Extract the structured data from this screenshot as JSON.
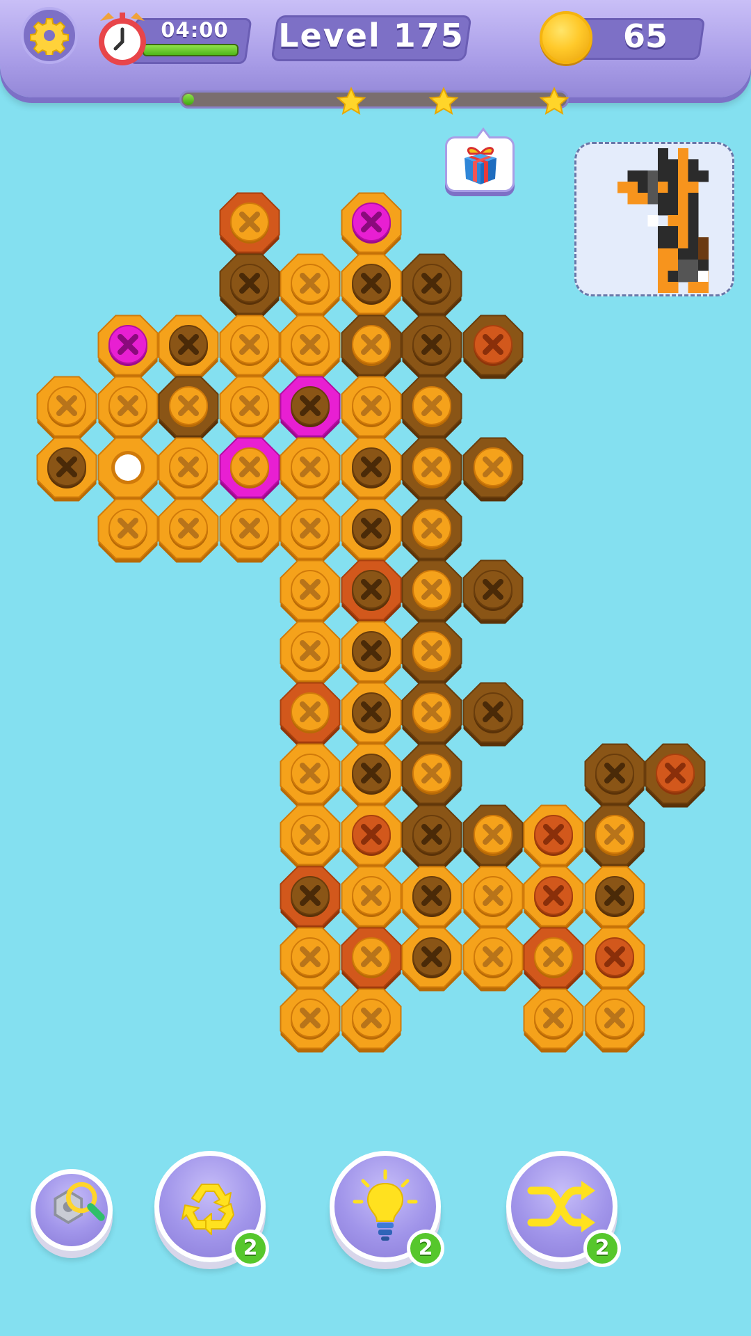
{
  "header": {
    "timer": "04:00",
    "timer_fraction": 1.0,
    "level_label": "Level 175",
    "coins": "65",
    "progress_fraction": 0.01,
    "stars": [
      "star-icon",
      "star-icon",
      "star-icon"
    ],
    "icons": {
      "settings": "gear-icon",
      "timer": "alarm-clock-icon",
      "coin": "coin-icon"
    }
  },
  "reward": {
    "icon": "gift-icon"
  },
  "target": {
    "icon": "pixel-giraffe-icon",
    "colors": {
      "black": "#2b2b2b",
      "gray": "#555555",
      "orange": "#f7941d",
      "white": "#ffffff",
      "brown": "#6b3a12"
    }
  },
  "bolt_colors": {
    "O": {
      "cap": "#f5a21b",
      "edge": "#d07a0a",
      "dark": "#b86a06",
      "hole": "#f7a826",
      "x": "#b8741a"
    },
    "D": {
      "cap": "#8a5516",
      "edge": "#6a3d0c",
      "dark": "#5a3208",
      "hole": "#7a4a12",
      "x": "#4a2a08"
    },
    "R": {
      "cap": "#d2581c",
      "edge": "#a9400e",
      "dark": "#8f350a",
      "hole": "#d2581c",
      "x": "#8a2f0a"
    },
    "P": {
      "cap": "#e81fd2",
      "edge": "#b40ea2",
      "dark": "#9c0a8d",
      "hole": "#e81fd2",
      "x": "#8a0a7c"
    }
  },
  "board": [
    {
      "r": 0,
      "c": 3,
      "rim": "R",
      "ctr": "O"
    },
    {
      "r": 0,
      "c": 5,
      "rim": "O",
      "ctr": "P"
    },
    {
      "r": 1,
      "c": 3,
      "rim": "D",
      "ctr": "D"
    },
    {
      "r": 1,
      "c": 4,
      "rim": "O",
      "ctr": "O"
    },
    {
      "r": 1,
      "c": 5,
      "rim": "O",
      "ctr": "D"
    },
    {
      "r": 1,
      "c": 6,
      "rim": "D",
      "ctr": "D"
    },
    {
      "r": 2,
      "c": 1,
      "rim": "O",
      "ctr": "P"
    },
    {
      "r": 2,
      "c": 2,
      "rim": "O",
      "ctr": "D"
    },
    {
      "r": 2,
      "c": 3,
      "rim": "O",
      "ctr": "O"
    },
    {
      "r": 2,
      "c": 4,
      "rim": "O",
      "ctr": "O"
    },
    {
      "r": 2,
      "c": 5,
      "rim": "D",
      "ctr": "O"
    },
    {
      "r": 2,
      "c": 6,
      "rim": "D",
      "ctr": "D"
    },
    {
      "r": 2,
      "c": 7,
      "rim": "D",
      "ctr": "R"
    },
    {
      "r": 3,
      "c": 0,
      "rim": "O",
      "ctr": "O"
    },
    {
      "r": 3,
      "c": 1,
      "rim": "O",
      "ctr": "O"
    },
    {
      "r": 3,
      "c": 2,
      "rim": "D",
      "ctr": "O"
    },
    {
      "r": 3,
      "c": 3,
      "rim": "O",
      "ctr": "O"
    },
    {
      "r": 3,
      "c": 4,
      "rim": "P",
      "ctr": "D"
    },
    {
      "r": 3,
      "c": 5,
      "rim": "O",
      "ctr": "O"
    },
    {
      "r": 3,
      "c": 6,
      "rim": "D",
      "ctr": "O"
    },
    {
      "r": 4,
      "c": 0,
      "rim": "O",
      "ctr": "D"
    },
    {
      "r": 4,
      "c": 1,
      "rim": "O",
      "ctr": "E"
    },
    {
      "r": 4,
      "c": 2,
      "rim": "O",
      "ctr": "O"
    },
    {
      "r": 4,
      "c": 3,
      "rim": "P",
      "ctr": "O"
    },
    {
      "r": 4,
      "c": 4,
      "rim": "O",
      "ctr": "O"
    },
    {
      "r": 4,
      "c": 5,
      "rim": "O",
      "ctr": "D"
    },
    {
      "r": 4,
      "c": 6,
      "rim": "D",
      "ctr": "O"
    },
    {
      "r": 4,
      "c": 7,
      "rim": "D",
      "ctr": "O"
    },
    {
      "r": 5,
      "c": 1,
      "rim": "O",
      "ctr": "O"
    },
    {
      "r": 5,
      "c": 2,
      "rim": "O",
      "ctr": "O"
    },
    {
      "r": 5,
      "c": 3,
      "rim": "O",
      "ctr": "O"
    },
    {
      "r": 5,
      "c": 4,
      "rim": "O",
      "ctr": "O"
    },
    {
      "r": 5,
      "c": 5,
      "rim": "O",
      "ctr": "D"
    },
    {
      "r": 5,
      "c": 6,
      "rim": "D",
      "ctr": "O"
    },
    {
      "r": 6,
      "c": 4,
      "rim": "O",
      "ctr": "O"
    },
    {
      "r": 6,
      "c": 5,
      "rim": "R",
      "ctr": "D"
    },
    {
      "r": 6,
      "c": 6,
      "rim": "D",
      "ctr": "O"
    },
    {
      "r": 6,
      "c": 7,
      "rim": "D",
      "ctr": "D"
    },
    {
      "r": 7,
      "c": 4,
      "rim": "O",
      "ctr": "O"
    },
    {
      "r": 7,
      "c": 5,
      "rim": "O",
      "ctr": "D"
    },
    {
      "r": 7,
      "c": 6,
      "rim": "D",
      "ctr": "O"
    },
    {
      "r": 8,
      "c": 4,
      "rim": "R",
      "ctr": "O"
    },
    {
      "r": 8,
      "c": 5,
      "rim": "O",
      "ctr": "D"
    },
    {
      "r": 8,
      "c": 6,
      "rim": "D",
      "ctr": "O"
    },
    {
      "r": 8,
      "c": 7,
      "rim": "D",
      "ctr": "D"
    },
    {
      "r": 9,
      "c": 4,
      "rim": "O",
      "ctr": "O"
    },
    {
      "r": 9,
      "c": 5,
      "rim": "O",
      "ctr": "D"
    },
    {
      "r": 9,
      "c": 6,
      "rim": "D",
      "ctr": "O"
    },
    {
      "r": 9,
      "c": 9,
      "rim": "D",
      "ctr": "D"
    },
    {
      "r": 9,
      "c": 10,
      "rim": "D",
      "ctr": "R"
    },
    {
      "r": 10,
      "c": 4,
      "rim": "O",
      "ctr": "O"
    },
    {
      "r": 10,
      "c": 5,
      "rim": "O",
      "ctr": "R"
    },
    {
      "r": 10,
      "c": 6,
      "rim": "D",
      "ctr": "D"
    },
    {
      "r": 10,
      "c": 7,
      "rim": "D",
      "ctr": "O"
    },
    {
      "r": 10,
      "c": 8,
      "rim": "O",
      "ctr": "R"
    },
    {
      "r": 10,
      "c": 9,
      "rim": "D",
      "ctr": "O"
    },
    {
      "r": 11,
      "c": 4,
      "rim": "R",
      "ctr": "D"
    },
    {
      "r": 11,
      "c": 5,
      "rim": "O",
      "ctr": "O"
    },
    {
      "r": 11,
      "c": 6,
      "rim": "O",
      "ctr": "D"
    },
    {
      "r": 11,
      "c": 7,
      "rim": "O",
      "ctr": "O"
    },
    {
      "r": 11,
      "c": 8,
      "rim": "O",
      "ctr": "R"
    },
    {
      "r": 11,
      "c": 9,
      "rim": "O",
      "ctr": "D"
    },
    {
      "r": 12,
      "c": 4,
      "rim": "O",
      "ctr": "O"
    },
    {
      "r": 12,
      "c": 5,
      "rim": "R",
      "ctr": "O"
    },
    {
      "r": 12,
      "c": 6,
      "rim": "O",
      "ctr": "D"
    },
    {
      "r": 12,
      "c": 7,
      "rim": "O",
      "ctr": "O"
    },
    {
      "r": 12,
      "c": 8,
      "rim": "R",
      "ctr": "O"
    },
    {
      "r": 12,
      "c": 9,
      "rim": "O",
      "ctr": "R"
    },
    {
      "r": 13,
      "c": 4,
      "rim": "O",
      "ctr": "O"
    },
    {
      "r": 13,
      "c": 5,
      "rim": "O",
      "ctr": "O"
    },
    {
      "r": 13,
      "c": 8,
      "rim": "O",
      "ctr": "O"
    },
    {
      "r": 13,
      "c": 9,
      "rim": "O",
      "ctr": "O"
    }
  ],
  "tools": [
    {
      "name": "magnifier-tool",
      "icon": "magnifier-icon",
      "count": ""
    },
    {
      "name": "recycle-tool",
      "icon": "recycle-icon",
      "count": "2"
    },
    {
      "name": "hint-tool",
      "icon": "lightbulb-icon",
      "count": "2"
    },
    {
      "name": "shuffle-tool",
      "icon": "shuffle-icon",
      "count": "2"
    }
  ]
}
